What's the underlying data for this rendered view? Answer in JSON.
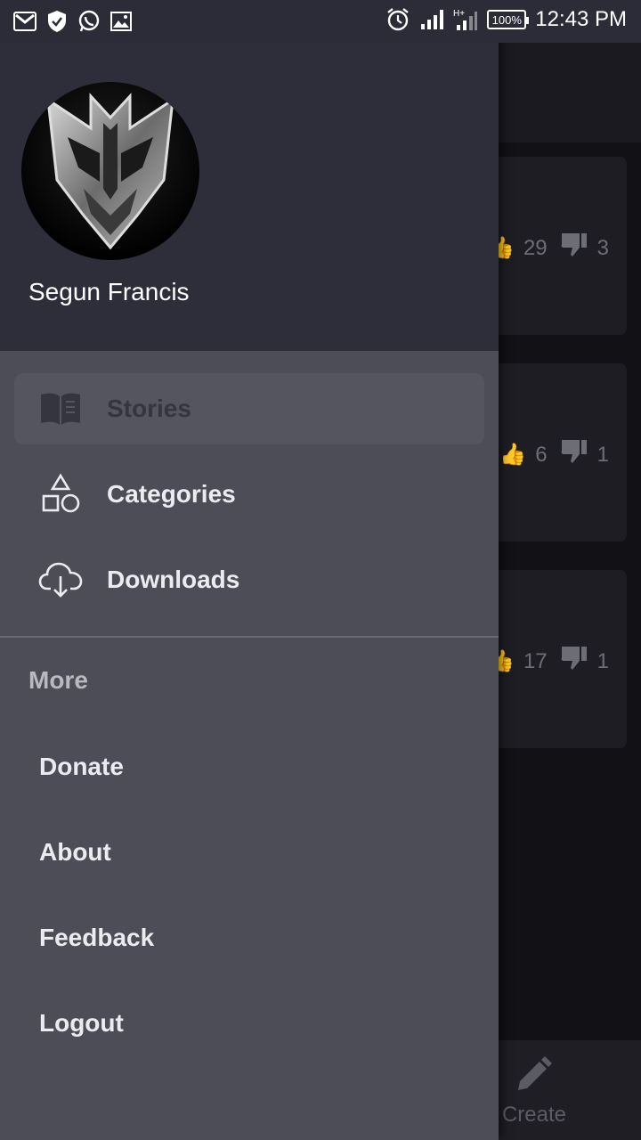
{
  "status_bar": {
    "time": "12:43 PM",
    "battery": "100%",
    "left_icons": [
      "gmail-icon",
      "shield-icon",
      "whatsapp-icon",
      "gallery-icon"
    ],
    "right_icons": [
      "alarm-icon",
      "signal-icon",
      "signal-ht-icon",
      "battery-icon"
    ]
  },
  "drawer": {
    "user_name": "Segun Francis",
    "nav": [
      {
        "label": "Stories",
        "icon": "book-open-icon",
        "active": true
      },
      {
        "label": "Categories",
        "icon": "shapes-icon",
        "active": false
      },
      {
        "label": "Downloads",
        "icon": "cloud-download-icon",
        "active": false
      }
    ],
    "section_title": "More",
    "links": [
      "Donate",
      "About",
      "Feedback",
      "Logout"
    ]
  },
  "background_app": {
    "cards": [
      {
        "likes": "29",
        "dislikes": "3"
      },
      {
        "likes": "6",
        "dislikes": "1"
      },
      {
        "likes": "17",
        "dislikes": "1"
      }
    ],
    "bottom_nav_visible_label": "Create"
  },
  "colors": {
    "drawer_bg": "#4d4d57",
    "header_bg": "#2e2e3a",
    "active_item_bg": "#555560",
    "statusbar_bg": "#2c2c38"
  }
}
